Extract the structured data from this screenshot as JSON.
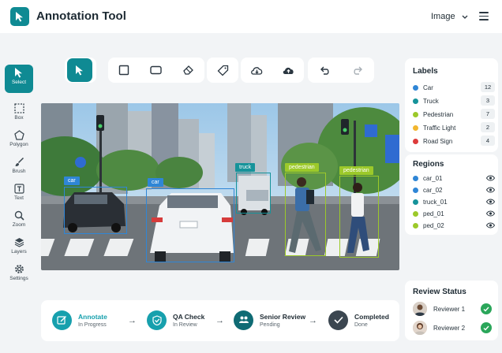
{
  "header": {
    "title": "Annotation Tool",
    "view_select": "Image"
  },
  "sidebar": {
    "tools": [
      {
        "label": "Select",
        "icon": "cursor-icon"
      },
      {
        "label": "Box",
        "icon": "box-icon"
      },
      {
        "label": "Polygon",
        "icon": "polygon-icon"
      },
      {
        "label": "Brush",
        "icon": "brush-icon"
      },
      {
        "label": "Text",
        "icon": "text-icon"
      },
      {
        "label": "Zoom",
        "icon": "zoom-icon"
      },
      {
        "label": "Layers",
        "icon": "layers-icon"
      },
      {
        "label": "Settings",
        "icon": "settings-icon"
      }
    ]
  },
  "toolbar": {
    "icons": [
      "cursor-icon",
      "rectangle-icon",
      "rounded-rectangle-icon",
      "eraser-icon",
      "tag-icon",
      "cloud-download-icon",
      "cloud-upload-icon",
      "undo-icon",
      "redo-icon"
    ]
  },
  "canvas": {
    "boxes": [
      {
        "label": "car",
        "color": "#2f86d6"
      },
      {
        "label": "car",
        "color": "#2f86d6"
      },
      {
        "label": "truck",
        "color": "#16939a"
      },
      {
        "label": "pedestrian",
        "color": "#9cc92a"
      },
      {
        "label": "pedestrian",
        "color": "#9cc92a"
      }
    ]
  },
  "labels": {
    "title": "Labels",
    "items": [
      {
        "name": "Car",
        "count": "12",
        "color": "#2f86d6"
      },
      {
        "name": "Truck",
        "count": "3",
        "color": "#16939a"
      },
      {
        "name": "Pedestrian",
        "count": "7",
        "color": "#9cc92a"
      },
      {
        "name": "Traffic Light",
        "count": "2",
        "color": "#f2b62e"
      },
      {
        "name": "Road Sign",
        "count": "4",
        "color": "#dd3b3b"
      }
    ]
  },
  "regions": {
    "title": "Regions",
    "items": [
      {
        "name": "car_01",
        "color": "#2f86d6"
      },
      {
        "name": "car_02",
        "color": "#2f86d6"
      },
      {
        "name": "truck_01",
        "color": "#16939a"
      },
      {
        "name": "ped_01",
        "color": "#9cc92a"
      },
      {
        "name": "ped_02",
        "color": "#9cc92a"
      }
    ]
  },
  "workflow": {
    "steps": [
      {
        "title": "Annotate",
        "status": "In Progress",
        "color": "#17a0ad"
      },
      {
        "title": "QA Check",
        "status": "In Review",
        "color": "#17a0ad"
      },
      {
        "title": "Senior Review",
        "status": "Pending",
        "color": "#0f6b74"
      },
      {
        "title": "Completed",
        "status": "Done",
        "color": "#3b4650"
      }
    ]
  },
  "review": {
    "title": "Review Status",
    "reviewers": [
      {
        "name": "Reviewer 1"
      },
      {
        "name": "Reviewer 2"
      }
    ]
  }
}
